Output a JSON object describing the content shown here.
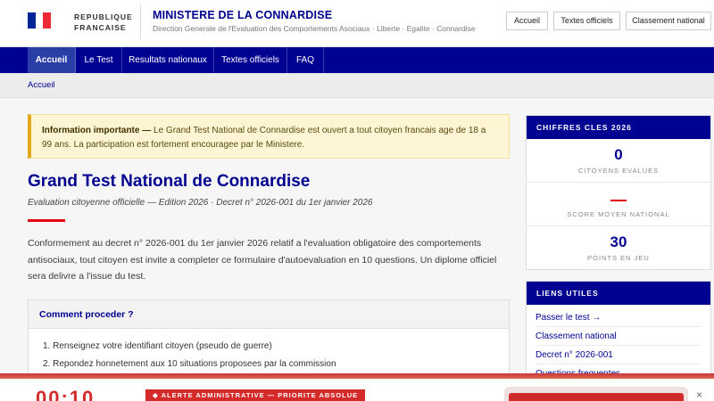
{
  "header": {
    "republic_line1": "REPUBLIQUE",
    "republic_line2": "FRANCAISE",
    "title": "MINISTERE DE LA CONNARDISE",
    "subtitle": "Direction Generale de l'Evaluation des Comportements Asociaux · Liberte · Egalite · Connardise",
    "buttons": [
      "Accueil",
      "Textes officiels",
      "Classement national"
    ]
  },
  "nav": {
    "items": [
      "Accueil",
      "Le Test",
      "Resultats nationaux",
      "Textes officiels",
      "FAQ"
    ],
    "active": "Accueil"
  },
  "breadcrumb": "Accueil",
  "notice": {
    "lead": "Information importante —",
    "text": " Le Grand Test National de Connardise est ouvert a tout citoyen francais age de 18 a 99 ans. La participation est fortement encouragee par le Ministere."
  },
  "main": {
    "title": "Grand Test National de Connardise",
    "subtitle": "Evaluation citoyenne officielle — Edition 2026 · Decret n° 2026-001 du 1er janvier 2026",
    "intro": "Conformement au decret n° 2026-001 du 1er janvier 2026 relatif a l'evaluation obligatoire des comportements antisociaux, tout citoyen est invite a completer ce formulaire d'autoevaluation en 10 questions. Un diplome officiel sera delivre a l'issue du test."
  },
  "how": {
    "title": "Comment proceder ?",
    "steps": [
      "1. Renseignez votre identifiant citoyen (pseudo de guerre)",
      "2. Repondez honnetement aux 10 situations proposees par la commission"
    ]
  },
  "stats": {
    "title": "CHIFFRES CLES 2026",
    "items": [
      {
        "value": "0",
        "label": "CITOYENS EVALUES"
      },
      {
        "value": "",
        "label": "SCORE MOYEN NATIONAL"
      },
      {
        "value": "30",
        "label": "POINTS EN JEU"
      }
    ]
  },
  "links": {
    "title": "LIENS UTILES",
    "items": [
      "Passer le test →",
      "Classement national",
      "Decret n° 2026-001",
      "Questions frequentes"
    ]
  },
  "bottom_bar": {
    "counter": "00:10",
    "badge": "ALERTE ADMINISTRATIVE — PRIORITE ABSOLUE",
    "close": "×"
  },
  "colors": {
    "brand_blue": "#000091",
    "accent_red": "#e1000f",
    "notice_bg": "#fef5d4"
  }
}
